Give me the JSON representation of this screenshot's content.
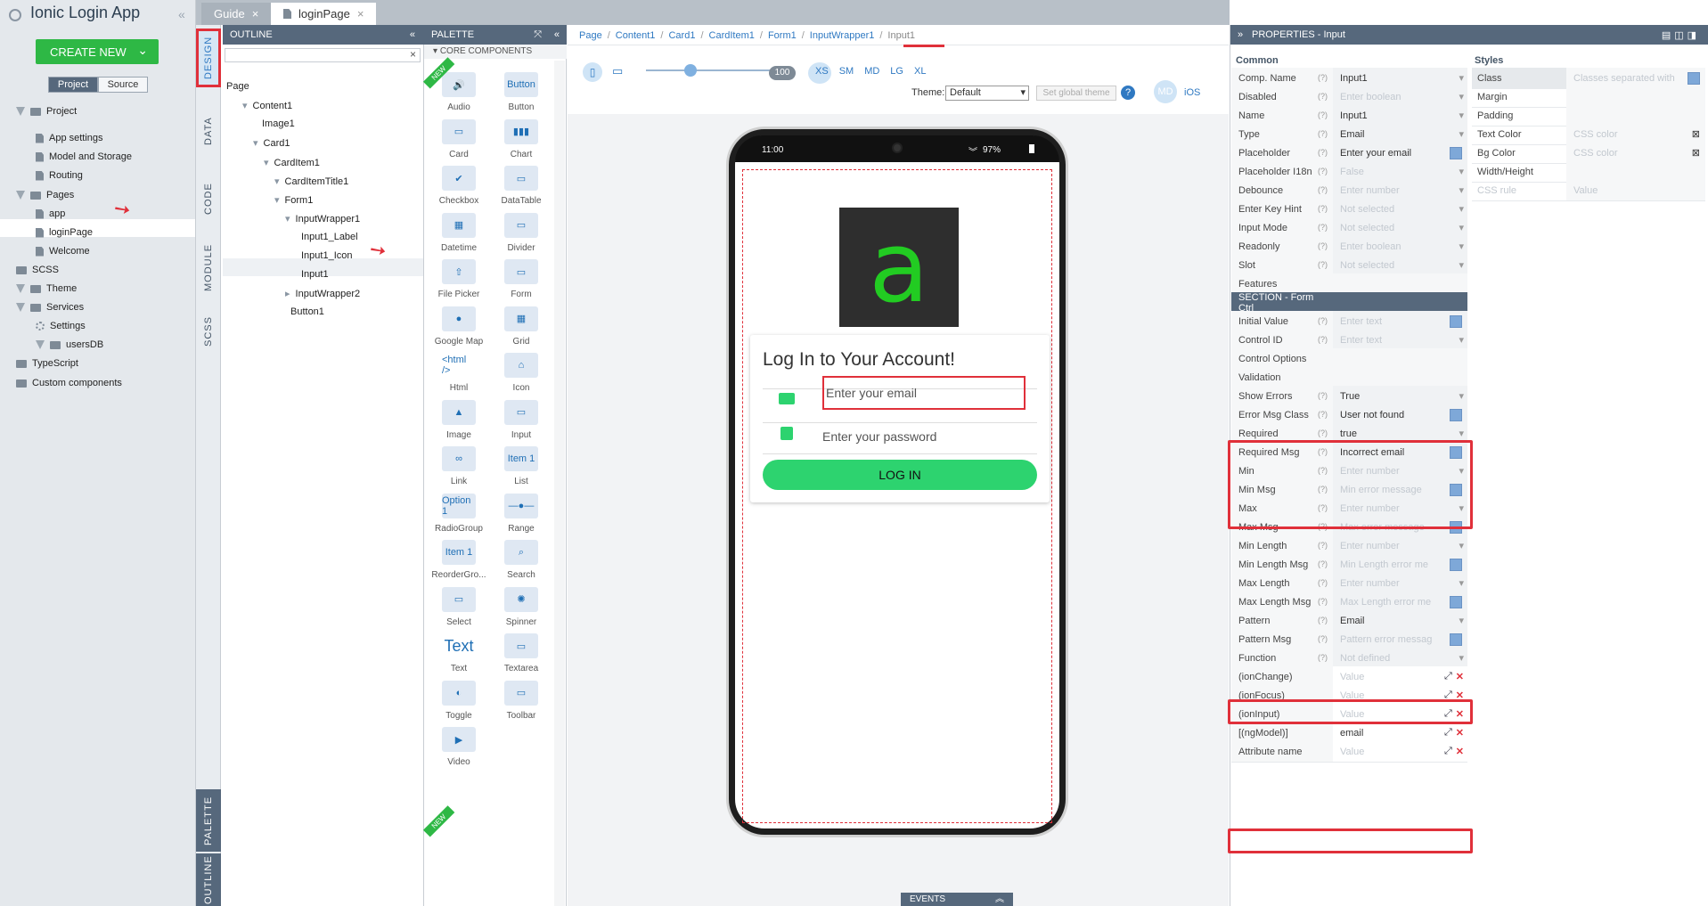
{
  "app": {
    "title": "Ionic Login App",
    "create_label": "CREATE NEW",
    "project_tab": "Project",
    "source_tab": "Source"
  },
  "project_tree": [
    {
      "label": "Project"
    },
    {
      "label": "App settings"
    },
    {
      "label": "Model and Storage"
    },
    {
      "label": "Routing"
    },
    {
      "label": "Pages"
    },
    {
      "label": "app"
    },
    {
      "label": "loginPage"
    },
    {
      "label": "Welcome"
    },
    {
      "label": "SCSS"
    },
    {
      "label": "Theme"
    },
    {
      "label": "Services"
    },
    {
      "label": "Settings"
    },
    {
      "label": "usersDB"
    },
    {
      "label": "TypeScript"
    },
    {
      "label": "Custom components"
    }
  ],
  "editor_tabs": [
    {
      "label": "Guide"
    },
    {
      "label": "loginPage"
    }
  ],
  "side_tabs": {
    "design": "DESIGN",
    "data": "DATA",
    "code": "CODE",
    "module": "MODULE",
    "scss": "SCSS",
    "palette": "PALETTE",
    "outline": "OUTLINE"
  },
  "outline": {
    "title": "OUTLINE",
    "items": [
      {
        "label": "Page"
      },
      {
        "label": "Content1"
      },
      {
        "label": "Image1"
      },
      {
        "label": "Card1"
      },
      {
        "label": "CardItem1"
      },
      {
        "label": "CardItemTitle1"
      },
      {
        "label": "Form1"
      },
      {
        "label": "InputWrapper1"
      },
      {
        "label": "Input1_Label"
      },
      {
        "label": "Input1_Icon"
      },
      {
        "label": "Input1"
      },
      {
        "label": "InputWrapper2"
      },
      {
        "label": "Button1"
      }
    ]
  },
  "palette": {
    "title": "PALETTE",
    "section": "CORE COMPONENTS",
    "items": [
      {
        "label": "Audio",
        "icon": "speaker-icon"
      },
      {
        "label": "Button",
        "icon": "button-icon",
        "glyph": "Button"
      },
      {
        "label": "Card",
        "icon": "card-icon"
      },
      {
        "label": "Chart",
        "icon": "chart-icon"
      },
      {
        "label": "Checkbox",
        "icon": "checkbox-icon"
      },
      {
        "label": "DataTable",
        "icon": "table-icon"
      },
      {
        "label": "Datetime",
        "icon": "calendar-icon"
      },
      {
        "label": "Divider",
        "icon": "divider-icon"
      },
      {
        "label": "File Picker",
        "icon": "upload-icon"
      },
      {
        "label": "Form",
        "icon": "form-icon"
      },
      {
        "label": "Google Map",
        "icon": "map-pin-icon"
      },
      {
        "label": "Grid",
        "icon": "grid-icon"
      },
      {
        "label": "Html",
        "icon": "html-icon",
        "glyph": "<html />"
      },
      {
        "label": "Icon",
        "icon": "home-icon"
      },
      {
        "label": "Image",
        "icon": "image-icon"
      },
      {
        "label": "Input",
        "icon": "input-icon"
      },
      {
        "label": "Link",
        "icon": "link-icon"
      },
      {
        "label": "List",
        "icon": "list-icon",
        "glyph": "Item 1"
      },
      {
        "label": "RadioGroup",
        "icon": "radio-icon",
        "glyph": "Option 1"
      },
      {
        "label": "Range",
        "icon": "range-icon"
      },
      {
        "label": "ReorderGro...",
        "icon": "reorder-icon",
        "glyph": "Item 1"
      },
      {
        "label": "Search",
        "icon": "search-icon"
      },
      {
        "label": "Select",
        "icon": "select-icon"
      },
      {
        "label": "Spinner",
        "icon": "spinner-icon"
      },
      {
        "label": "Text",
        "icon": "text-icon",
        "glyph": "Text"
      },
      {
        "label": "Textarea",
        "icon": "textarea-icon"
      },
      {
        "label": "Toggle",
        "icon": "toggle-icon"
      },
      {
        "label": "Toolbar",
        "icon": "toolbar-icon"
      },
      {
        "label": "Video",
        "icon": "video-icon"
      }
    ],
    "new_badge": "NEW"
  },
  "breadcrumb": [
    {
      "label": "Page"
    },
    {
      "label": "Content1"
    },
    {
      "label": "Card1"
    },
    {
      "label": "CardItem1"
    },
    {
      "label": "Form1"
    },
    {
      "label": "InputWrapper1"
    },
    {
      "label": "Input1"
    }
  ],
  "canvas_toolbar": {
    "zoom": "100",
    "sizes": [
      "XS",
      "SM",
      "MD",
      "LG",
      "XL"
    ],
    "theme_label": "Theme:",
    "theme_value": "Default",
    "global_theme": "Set global theme",
    "md": "MD",
    "ios": "iOS"
  },
  "phone": {
    "time": "11:00",
    "battery": "97%",
    "logo_letter": "a",
    "card_title": "Log In to Your Account!",
    "email_placeholder": "Enter your email",
    "password_placeholder": "Enter your password",
    "login_label": "LOG IN"
  },
  "events_label": "EVENTS",
  "properties": {
    "title": "PROPERTIES - Input",
    "common": "Common",
    "styles": "Styles",
    "rows": [
      {
        "k": "Comp. Name",
        "v": "Input1"
      },
      {
        "k": "Disabled",
        "v": "Enter boolean",
        "p": true
      },
      {
        "k": "Name",
        "v": "Input1"
      },
      {
        "k": "Type",
        "v": "Email"
      },
      {
        "k": "Placeholder",
        "v": "Enter your email"
      },
      {
        "k": "Placeholder I18n",
        "v": "False",
        "p": true
      },
      {
        "k": "Debounce",
        "v": "Enter number",
        "p": true
      },
      {
        "k": "Enter Key Hint",
        "v": "Not selected",
        "p": true
      },
      {
        "k": "Input Mode",
        "v": "Not selected",
        "p": true
      },
      {
        "k": "Readonly",
        "v": "Enter boolean",
        "p": true
      },
      {
        "k": "Slot",
        "v": "Not selected",
        "p": true
      },
      {
        "k": "Features",
        "v": ""
      },
      {
        "k": "SECTION - Form Ctrl",
        "v": ""
      },
      {
        "k": "Initial Value",
        "v": "Enter text",
        "p": true
      },
      {
        "k": "Control ID",
        "v": "Enter text",
        "p": true
      },
      {
        "k": "Control Options",
        "v": ""
      },
      {
        "k": "Validation",
        "v": ""
      },
      {
        "k": "Show Errors",
        "v": "True"
      },
      {
        "k": "Error Msg Class",
        "v": "User not found"
      },
      {
        "k": "Required",
        "v": "true"
      },
      {
        "k": "Required Msg",
        "v": "Incorrect email"
      },
      {
        "k": "Min",
        "v": "Enter number",
        "p": true
      },
      {
        "k": "Min Msg",
        "v": "Min error message",
        "p": true
      },
      {
        "k": "Max",
        "v": "Enter number",
        "p": true
      },
      {
        "k": "Max Msg",
        "v": "Max error message",
        "p": true
      },
      {
        "k": "Min Length",
        "v": "Enter number",
        "p": true
      },
      {
        "k": "Min Length Msg",
        "v": "Min Length error me",
        "p": true
      },
      {
        "k": "Max Length",
        "v": "Enter number",
        "p": true
      },
      {
        "k": "Max Length Msg",
        "v": "Max Length error me",
        "p": true
      },
      {
        "k": "Pattern",
        "v": "Email"
      },
      {
        "k": "Pattern Msg",
        "v": "Pattern error messag",
        "p": true
      },
      {
        "k": "Function",
        "v": "Not defined",
        "p": true
      },
      {
        "k": "(ionChange)",
        "v": "Value",
        "p": true
      },
      {
        "k": "(ionFocus)",
        "v": "Value",
        "p": true
      },
      {
        "k": "(ionInput)",
        "v": "Value",
        "p": true
      },
      {
        "k": "[(ngModel)]",
        "v": "email"
      },
      {
        "k": "Attribute name",
        "v": "Value",
        "p": true
      }
    ],
    "style_rows": [
      {
        "k": "Class",
        "v": "Classes separated with"
      },
      {
        "k": "Margin",
        "v": ""
      },
      {
        "k": "Padding",
        "v": ""
      },
      {
        "k": "Text Color",
        "v": "CSS color"
      },
      {
        "k": "Bg Color",
        "v": "CSS color"
      },
      {
        "k": "Width/Height",
        "v": ""
      },
      {
        "k": "CSS rule",
        "v": "Value"
      }
    ]
  },
  "colors": {
    "accent": "#2eb845",
    "header": "#56687c",
    "highlight": "#e0303a",
    "link": "#2f79c2"
  }
}
